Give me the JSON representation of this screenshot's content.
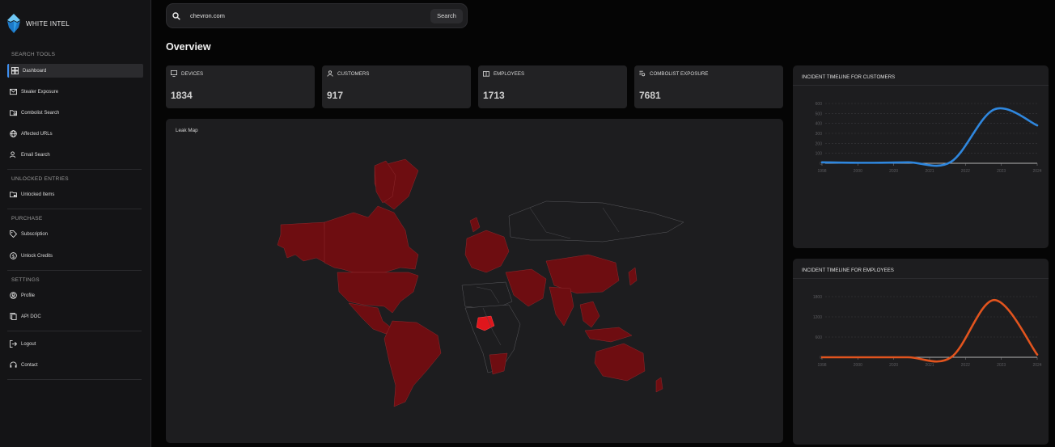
{
  "brand": {
    "name": "WHITE INTEL",
    "icon": "iceberg-logo-icon"
  },
  "sidebar": {
    "sections": [
      {
        "title": "SEARCH TOOLS",
        "items": [
          {
            "label": "Dashboard",
            "icon": "dashboard-icon",
            "active": true
          },
          {
            "label": "Stealer Exposure",
            "icon": "mail-icon"
          },
          {
            "label": "Combolist Search",
            "icon": "folder-search-icon"
          },
          {
            "label": "Affected URLs",
            "icon": "globe-icon"
          },
          {
            "label": "Email Search",
            "icon": "user-search-icon"
          }
        ]
      },
      {
        "title": "UNLOCKED ENTRIES",
        "items": [
          {
            "label": "Unlocked Items",
            "icon": "unlocked-folder-icon"
          }
        ]
      },
      {
        "title": "PURCHASE",
        "items": [
          {
            "label": "Subscription",
            "icon": "tag-icon"
          },
          {
            "label": "Unlock Credits",
            "icon": "dollar-icon"
          }
        ]
      },
      {
        "title": "SETTINGS",
        "items": [
          {
            "label": "Profile",
            "icon": "profile-icon"
          },
          {
            "label": "API DOC",
            "icon": "document-icon"
          }
        ]
      }
    ],
    "footer": [
      {
        "label": "Logout",
        "icon": "logout-icon"
      },
      {
        "label": "Contact",
        "icon": "headset-icon"
      }
    ]
  },
  "search": {
    "value": "chevron.com",
    "button_label": "Search"
  },
  "page_title": "Overview",
  "stats": [
    {
      "label": "DEVICES",
      "value": "1834",
      "icon": "device-icon"
    },
    {
      "label": "CUSTOMERS",
      "value": "917",
      "icon": "user-icon"
    },
    {
      "label": "EMPLOYEES",
      "value": "1713",
      "icon": "badge-icon"
    },
    {
      "label": "COMBOLIST EXPOSURE",
      "value": "7681",
      "icon": "list-search-icon"
    }
  ],
  "map": {
    "title": "Leak Map",
    "highlight_color": "#e0161c",
    "country_color": "#7a0e12"
  },
  "timelines": [
    {
      "title": "INCIDENT TIMELINE FOR CUSTOMERS",
      "color": "#2f87de"
    },
    {
      "title": "INCIDENT TIMELINE FOR EMPLOYEES",
      "color": "#e2541e"
    }
  ],
  "chart_data": [
    {
      "type": "line",
      "title": "INCIDENT TIMELINE FOR CUSTOMERS",
      "x": [
        "2019",
        "2020",
        "2021",
        "2022",
        "2023",
        "2024"
      ],
      "series": [
        {
          "values": [
            10,
            5,
            10,
            15,
            540,
            380
          ]
        }
      ],
      "x_ticks": [
        "1998",
        "2000",
        "2020",
        "2021",
        "2022",
        "2023",
        "2024"
      ],
      "y_ticks": [
        0,
        100,
        200,
        300,
        400,
        500,
        600
      ],
      "ylim": [
        0,
        600
      ],
      "grid": true
    },
    {
      "type": "line",
      "title": "INCIDENT TIMELINE FOR EMPLOYEES",
      "x": [
        "2019",
        "2020",
        "2021",
        "2022",
        "2023",
        "2024"
      ],
      "series": [
        {
          "values": [
            0,
            0,
            0,
            0,
            1700,
            80
          ]
        }
      ],
      "x_ticks": [
        "1998",
        "2000",
        "2020",
        "2021",
        "2022",
        "2023",
        "2024"
      ],
      "y_ticks": [
        0,
        600,
        1200,
        1800
      ],
      "ylim": [
        0,
        1800
      ],
      "grid": true
    }
  ]
}
